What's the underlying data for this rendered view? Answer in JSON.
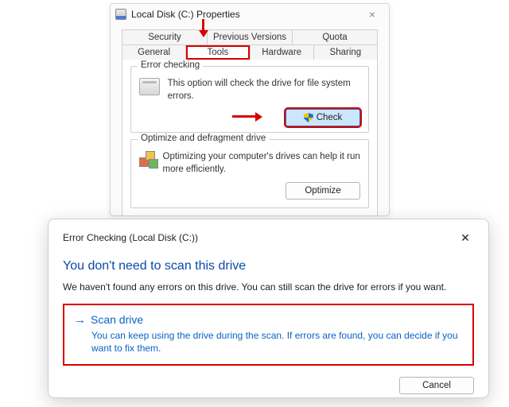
{
  "props": {
    "title": "Local Disk (C:) Properties",
    "tabs_row1": [
      "Security",
      "Previous Versions",
      "Quota"
    ],
    "tabs_row2": [
      "General",
      "Tools",
      "Hardware",
      "Sharing"
    ],
    "active_tab": "Tools",
    "groups": {
      "error_checking": {
        "legend": "Error checking",
        "desc": "This option will check the drive for file system errors.",
        "button_label": "Check"
      },
      "optimize": {
        "legend": "Optimize and defragment drive",
        "desc": "Optimizing your computer's drives can help it run more efficiently.",
        "button_label": "Optimize"
      }
    }
  },
  "errchk": {
    "title": "Error Checking (Local Disk (C:))",
    "heading": "You don't need to scan this drive",
    "body": "We haven't found any errors on this drive. You can still scan the drive for errors if you want.",
    "scan_option": {
      "title": "Scan drive",
      "desc": "You can keep using the drive during the scan. If errors are found, you can decide if you want to fix them."
    },
    "cancel_label": "Cancel"
  }
}
